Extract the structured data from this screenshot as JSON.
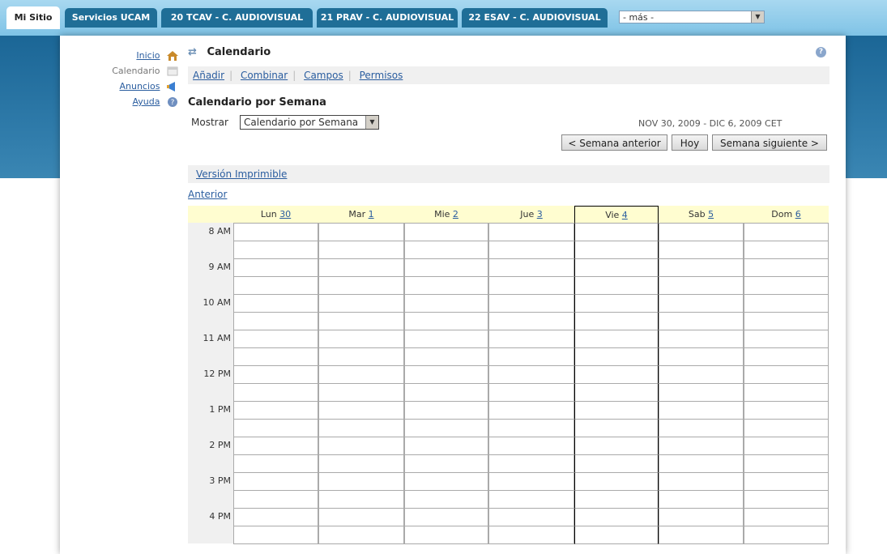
{
  "tabs": [
    "Mi Sitio",
    "Servicios UCAM",
    "20 TCAV - C. AUDIOVISUAL",
    "21 PRAV - C. AUDIOVISUAL",
    "22 ESAV - C. AUDIOVISUAL"
  ],
  "more_select": "- más -",
  "nav": [
    {
      "label": "Inicio",
      "icon": "home-icon"
    },
    {
      "label": "Calendario",
      "icon": "calendar-icon"
    },
    {
      "label": "Anuncios",
      "icon": "announcements-icon"
    },
    {
      "label": "Ayuda",
      "icon": "help-icon"
    }
  ],
  "tool_title": "Calendario",
  "actions": [
    "Añadir",
    "Combinar",
    "Campos",
    "Permisos"
  ],
  "page_heading": "Calendario por Semana",
  "mostrar_label": "Mostrar",
  "view_select": "Calendario por Semana",
  "date_range": "NOV 30, 2009 - DIC 6, 2009 CET",
  "buttons": {
    "prev": "< Semana anterior",
    "today": "Hoy",
    "next": "Semana siguiente >"
  },
  "print_link": "Versión Imprimible",
  "anterior_link": "Anterior",
  "days": [
    {
      "name": "Lun",
      "num": "30"
    },
    {
      "name": "Mar",
      "num": "1"
    },
    {
      "name": "Mie",
      "num": "2"
    },
    {
      "name": "Jue",
      "num": "3"
    },
    {
      "name": "Vie",
      "num": "4"
    },
    {
      "name": "Sab",
      "num": "5"
    },
    {
      "name": "Dom",
      "num": "6"
    }
  ],
  "hours": [
    "8 AM",
    "9 AM",
    "10 AM",
    "11 AM",
    "12 PM",
    "1 PM",
    "2 PM",
    "3 PM",
    "4 PM"
  ],
  "today_index": 4,
  "colors": {
    "tab": "#1f6e97",
    "banner": "#2d79a8",
    "link": "#2a5d9f",
    "header_bg": "#fffdd0"
  }
}
